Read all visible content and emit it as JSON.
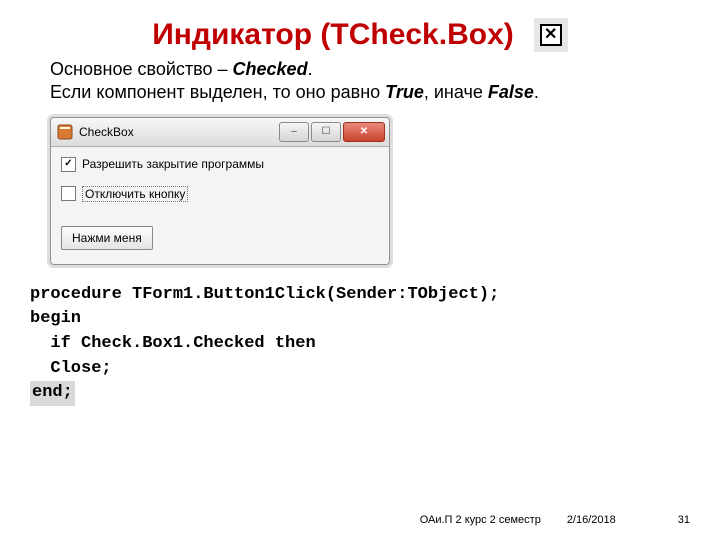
{
  "title": "Индикатор (TCheck.Box)",
  "check_icon_glyph": "✕",
  "desc": {
    "line1_prefix": "Основное свойство – ",
    "line1_em": "Checked",
    "line1_suffix": ".",
    "line2_prefix": "Если компонент выделен, то оно равно ",
    "line2_em1": "True",
    "line2_mid": ", иначе ",
    "line2_em2": "False",
    "line2_suffix": "."
  },
  "window": {
    "title": "CheckBox",
    "cb1": {
      "label": "Разрешить закрытие программы",
      "checked": true
    },
    "cb2": {
      "label": "Отключить кнопку",
      "checked": false
    },
    "button": "Нажми меня",
    "min_glyph": "‒",
    "max_glyph": "☐",
    "close_glyph": "✕"
  },
  "code": {
    "l1": "procedure TForm1.Button1Click(Sender:TObject);",
    "l2": "begin",
    "l3": "  if Check.Box1.Checked then",
    "l4": "  Close;",
    "l5": "end;"
  },
  "footer": {
    "course": "ОАи.П 2 курс 2 семестр",
    "date": "2/16/2018",
    "page": "31"
  }
}
